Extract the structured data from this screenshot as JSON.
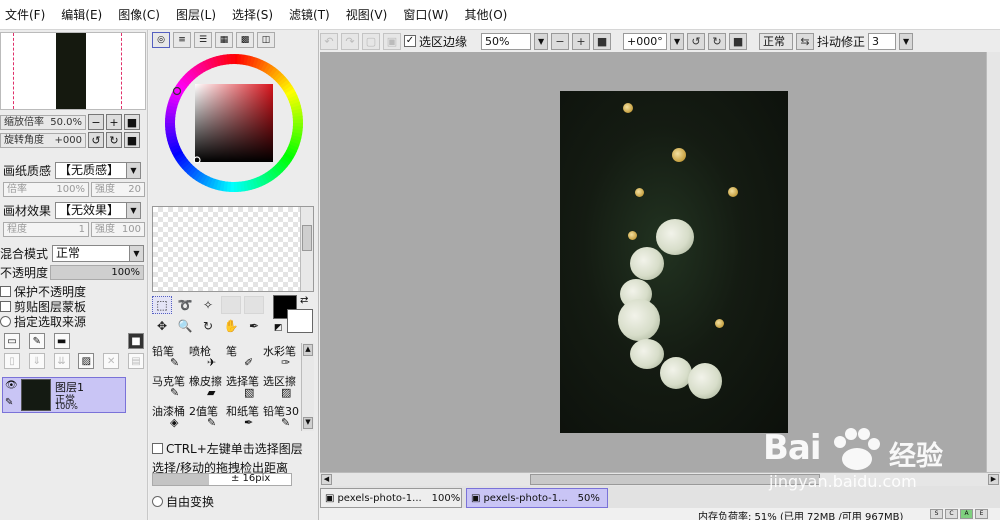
{
  "menu": [
    "文件(F)",
    "编辑(E)",
    "图像(C)",
    "图层(L)",
    "选择(S)",
    "滤镜(T)",
    "视图(V)",
    "窗口(W)",
    "其他(O)"
  ],
  "toolbar": {
    "selection_edge_label": "选区边缘",
    "zoom_value": "50%",
    "rotate_value": "+000°",
    "mode_button": "正常",
    "stabilizer_label": "抖动修正",
    "stabilizer_value": "3"
  },
  "navigator": {
    "zoom_label": "缩放倍率",
    "zoom_value": "50.0%",
    "rotate_label": "旋转角度",
    "rotate_value": "+000"
  },
  "texture": {
    "paper_label": "画纸质感",
    "paper_value": "【无质感】",
    "paper_scale_label": "倍率",
    "paper_scale_value": "100%",
    "paper_strength_label": "强度",
    "paper_strength_value": "20",
    "effect_label": "画材效果",
    "effect_value": "【无效果】",
    "effect_degree_label": "程度",
    "effect_degree_value": "1",
    "effect_strength_label": "强度",
    "effect_strength_value": "100"
  },
  "layer_props": {
    "blend_label": "混合模式",
    "blend_value": "正常",
    "opacity_label": "不透明度",
    "opacity_value": "100%",
    "protect_opacity": "保护不透明度",
    "clip_mask": "剪贴图层蒙板",
    "selection_source": "指定选取来源"
  },
  "layer": {
    "name": "图层1",
    "mode": "正常",
    "opacity": "100%"
  },
  "brushes": [
    {
      "label": "铅笔"
    },
    {
      "label": "喷枪"
    },
    {
      "label": "笔"
    },
    {
      "label": "水彩笔"
    },
    {
      "label": "马克笔"
    },
    {
      "label": "橡皮擦"
    },
    {
      "label": "选择笔"
    },
    {
      "label": "选区擦"
    },
    {
      "label": "油漆桶"
    },
    {
      "label": "2值笔"
    },
    {
      "label": "和纸笔"
    },
    {
      "label": "铅笔30"
    }
  ],
  "options": {
    "ctrl_select_label": "CTRL+左键单击选择图层",
    "drag_distance_label": "选择/移动的拖拽检出距离",
    "drag_distance_value": "± 16pix",
    "free_transform_label": "自由变换"
  },
  "documents": [
    {
      "name": "pexels-photo-1...",
      "zoom": "100%"
    },
    {
      "name": "pexels-photo-1...",
      "zoom": "50%"
    }
  ],
  "status": {
    "text": "内存负荷率: 51% (已用 72MB /可用 967MB)"
  },
  "watermark": {
    "brand": "Bai",
    "brand_cn": "经验",
    "url": "jingyan.baidu.com"
  },
  "colors": {
    "selection_accent": "#c9c5f5",
    "canvas_bg": "#a9a9a9",
    "guide_pink": "#e0306a"
  }
}
